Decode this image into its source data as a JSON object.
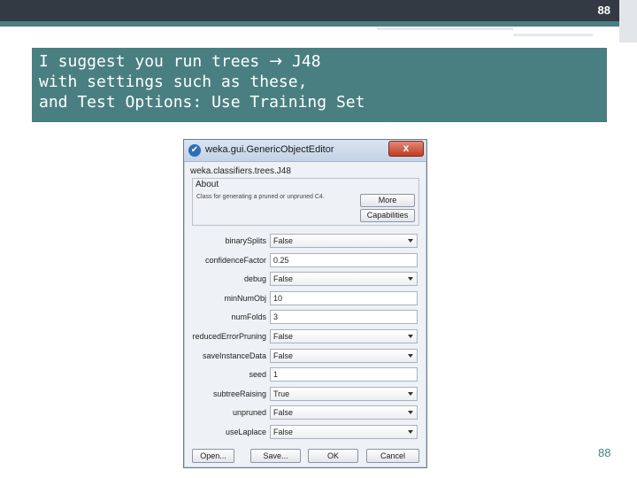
{
  "slide": {
    "number_top": "88",
    "number_bottom": "88",
    "title_lines": [
      "I suggest you run trees ",
      " J48",
      "with settings such as these,",
      "and Test Options: Use Training Set"
    ],
    "arrow_glyph": "→"
  },
  "colors": {
    "accent": "#4a7f82",
    "banner": "#333a44"
  },
  "dialog": {
    "title": "weka.gui.GenericObjectEditor",
    "close_glyph": "x",
    "classname": "weka.classifiers.trees.J48",
    "about_label": "About",
    "about_desc": "Class for generating a pruned or unpruned C4.",
    "more_label": "More",
    "capabilities_label": "Capabilities",
    "properties": [
      {
        "label": "binarySplits",
        "value": "False",
        "kind": "select"
      },
      {
        "label": "confidenceFactor",
        "value": "0.25",
        "kind": "text"
      },
      {
        "label": "debug",
        "value": "False",
        "kind": "select"
      },
      {
        "label": "minNumObj",
        "value": "10",
        "kind": "text"
      },
      {
        "label": "numFolds",
        "value": "3",
        "kind": "text"
      },
      {
        "label": "reducedErrorPruning",
        "value": "False",
        "kind": "select"
      },
      {
        "label": "saveInstanceData",
        "value": "False",
        "kind": "select"
      },
      {
        "label": "seed",
        "value": "1",
        "kind": "text"
      },
      {
        "label": "subtreeRaising",
        "value": "True",
        "kind": "select"
      },
      {
        "label": "unpruned",
        "value": "False",
        "kind": "select"
      },
      {
        "label": "useLaplace",
        "value": "False",
        "kind": "select"
      }
    ],
    "buttons": {
      "open": "Open...",
      "save": "Save...",
      "ok": "OK",
      "cancel": "Cancel"
    }
  }
}
